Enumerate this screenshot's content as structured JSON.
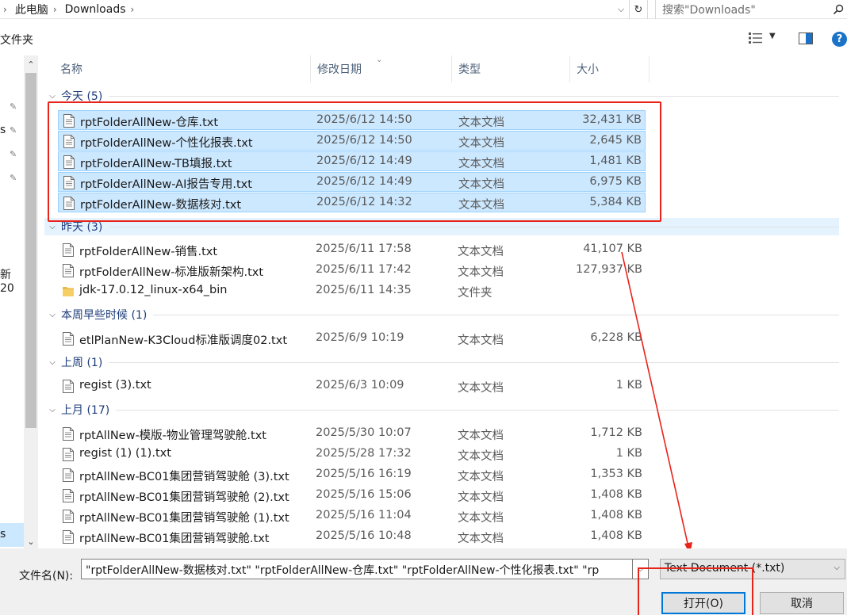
{
  "address": {
    "crumbs": [
      "此电脑",
      "Downloads"
    ],
    "search_placeholder": "搜索\"Downloads\""
  },
  "toolbar": {
    "new_folder_label": "文件夹"
  },
  "nav": {
    "fragments": [
      "s",
      "新20",
      "s"
    ]
  },
  "columns": {
    "name": "名称",
    "date": "修改日期",
    "type": "类型",
    "size": "大小"
  },
  "groups": [
    {
      "label": "今天 (5)",
      "items": [
        {
          "name": "rptFolderAllNew-仓库.txt",
          "date": "2025/6/12 14:50",
          "type": "文本文档",
          "size": "32,431 KB",
          "icon": "text-file-icon",
          "selected": true
        },
        {
          "name": "rptFolderAllNew-个性化报表.txt",
          "date": "2025/6/12 14:50",
          "type": "文本文档",
          "size": "2,645 KB",
          "icon": "text-file-icon",
          "selected": true
        },
        {
          "name": "rptFolderAllNew-TB填报.txt",
          "date": "2025/6/12 14:49",
          "type": "文本文档",
          "size": "1,481 KB",
          "icon": "text-file-icon",
          "selected": true
        },
        {
          "name": "rptFolderAllNew-AI报告专用.txt",
          "date": "2025/6/12 14:49",
          "type": "文本文档",
          "size": "6,975 KB",
          "icon": "text-file-icon",
          "selected": true
        },
        {
          "name": "rptFolderAllNew-数据核对.txt",
          "date": "2025/6/12 14:32",
          "type": "文本文档",
          "size": "5,384 KB",
          "icon": "text-file-icon",
          "selected": true
        }
      ]
    },
    {
      "label": "昨天 (3)",
      "items": [
        {
          "name": "rptFolderAllNew-销售.txt",
          "date": "2025/6/11 17:58",
          "type": "文本文档",
          "size": "41,107 KB",
          "icon": "text-file-icon",
          "selected": false
        },
        {
          "name": "rptFolderAllNew-标准版新架构.txt",
          "date": "2025/6/11 17:42",
          "type": "文本文档",
          "size": "127,937 KB",
          "icon": "text-file-icon",
          "selected": false
        },
        {
          "name": "jdk-17.0.12_linux-x64_bin",
          "date": "2025/6/11 14:35",
          "type": "文件夹",
          "size": "",
          "icon": "folder-icon",
          "selected": false
        }
      ]
    },
    {
      "label": "本周早些时候 (1)",
      "items": [
        {
          "name": "etlPlanNew-K3Cloud标准版调度02.txt",
          "date": "2025/6/9 10:19",
          "type": "文本文档",
          "size": "6,228 KB",
          "icon": "text-file-icon",
          "selected": false
        }
      ]
    },
    {
      "label": "上周 (1)",
      "items": [
        {
          "name": "regist (3).txt",
          "date": "2025/6/3 10:09",
          "type": "文本文档",
          "size": "1 KB",
          "icon": "text-file-icon",
          "selected": false
        }
      ]
    },
    {
      "label": "上月 (17)",
      "items": [
        {
          "name": "rptAllNew-模版-物业管理驾驶舱.txt",
          "date": "2025/5/30 10:07",
          "type": "文本文档",
          "size": "1,712 KB",
          "icon": "text-file-icon",
          "selected": false
        },
        {
          "name": "regist (1) (1).txt",
          "date": "2025/5/28 17:32",
          "type": "文本文档",
          "size": "1 KB",
          "icon": "text-file-icon",
          "selected": false
        },
        {
          "name": "rptAllNew-BC01集团营销驾驶舱 (3).txt",
          "date": "2025/5/16 16:19",
          "type": "文本文档",
          "size": "1,353 KB",
          "icon": "text-file-icon",
          "selected": false
        },
        {
          "name": "rptAllNew-BC01集团营销驾驶舱 (2).txt",
          "date": "2025/5/16 15:06",
          "type": "文本文档",
          "size": "1,408 KB",
          "icon": "text-file-icon",
          "selected": false
        },
        {
          "name": "rptAllNew-BC01集团营销驾驶舱 (1).txt",
          "date": "2025/5/16 11:04",
          "type": "文本文档",
          "size": "1,408 KB",
          "icon": "text-file-icon",
          "selected": false
        },
        {
          "name": "rptAllNew-BC01集团营销驾驶舱.txt",
          "date": "2025/5/16 10:48",
          "type": "文本文档",
          "size": "1,408 KB",
          "icon": "text-file-icon",
          "selected": false
        }
      ]
    }
  ],
  "bottom": {
    "filename_label": "文件名(N):",
    "filename_value": "\"rptFolderAllNew-数据核对.txt\" \"rptFolderAllNew-仓库.txt\" \"rptFolderAllNew-个性化报表.txt\" \"rp",
    "filter_value": "Text Document (*.txt)",
    "open_label": "打开(O)",
    "cancel_label": "取消"
  },
  "colors": {
    "selection": "#cce8ff",
    "annotation": "#e8231a",
    "group_text": "#1e3c7a"
  }
}
